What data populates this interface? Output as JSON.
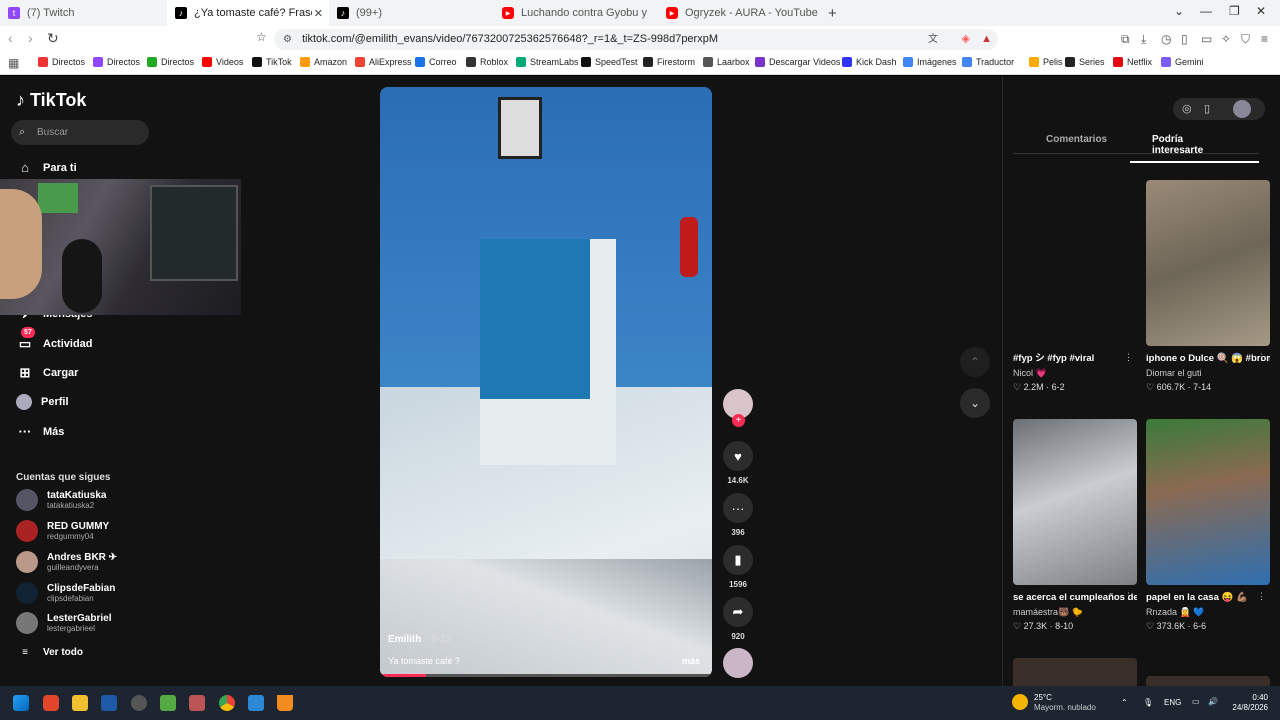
{
  "tabs": [
    {
      "label": "(7) Twitch",
      "color": "#9146ff",
      "glyph": "t"
    },
    {
      "label": "¿Ya tomaste café? Frases y respu...",
      "color": "#000",
      "glyph": "♪",
      "active": true
    },
    {
      "label": "(99+)",
      "color": "#000",
      "glyph": "♪"
    },
    {
      "label": "Luchando contra Gyobu y el Toro lla...",
      "color": "#ff0000",
      "glyph": "▶"
    },
    {
      "label": "Ogryzek - AURA - YouTube",
      "color": "#ff0000",
      "glyph": "▶"
    }
  ],
  "url": "tiktok.com/@emilith_evans/video/7673200725362576648?_r=1&_t=ZS-998d7perxpM",
  "bookmarks": [
    {
      "label": "Directos",
      "color": "#e33"
    },
    {
      "label": "Directos",
      "color": "#9146ff"
    },
    {
      "label": "Directos",
      "color": "#2a2"
    },
    {
      "label": "Videos",
      "color": "#f00"
    },
    {
      "label": "TikTok",
      "color": "#111"
    },
    {
      "label": "Amazon",
      "color": "#f90"
    },
    {
      "label": "AliExpress",
      "color": "#e43"
    },
    {
      "label": "Correo",
      "color": "#1a73e8"
    },
    {
      "label": "Roblox",
      "color": "#333"
    },
    {
      "label": "StreamLabs",
      "color": "#0a7"
    },
    {
      "label": "SpeedTest",
      "color": "#111"
    },
    {
      "label": "Firestorm",
      "color": "#222"
    },
    {
      "label": "Laarbox",
      "color": "#555"
    },
    {
      "label": "Descargar Videos",
      "color": "#73c"
    },
    {
      "label": "Kick Dash",
      "color": "#33f"
    },
    {
      "label": "Imágenes",
      "color": "#4285f4"
    },
    {
      "label": "Traductor",
      "color": "#4285f4"
    },
    {
      "label": "Pelis",
      "color": "#fa0"
    },
    {
      "label": "Series",
      "color": "#222"
    },
    {
      "label": "Netflix",
      "color": "#e50914"
    },
    {
      "label": "Gemini",
      "color": "#7b5cf5"
    }
  ],
  "sidebar": {
    "logo": "TikTok",
    "search_placeholder": "Buscar",
    "nav": [
      {
        "label": "Para ti",
        "icon": "⌂"
      },
      {
        "label": "Mensajes",
        "icon": "✈"
      },
      {
        "label": "Actividad",
        "icon": "▭",
        "badge": "57"
      },
      {
        "label": "Cargar",
        "icon": "⊞"
      },
      {
        "label": "Perfil",
        "icon": "●"
      },
      {
        "label": "Más",
        "icon": "···"
      }
    ],
    "following_title": "Cuentas que sigues",
    "accounts": [
      {
        "name": "tataKatiuska",
        "handle": "tatakatiuska2",
        "color": "#556"
      },
      {
        "name": "RED GUMMY",
        "handle": "redgummy04",
        "color": "#a22"
      },
      {
        "name": "Andres BKR ✈",
        "handle": "guilleandyvera",
        "color": "#b98"
      },
      {
        "name": "ClipsdeFabian",
        "handle": "clipsdefabian",
        "color": "#123"
      },
      {
        "name": "LesterGabriel",
        "handle": "lestergabrieel",
        "color": "#777"
      }
    ],
    "see_all": "Ver todo"
  },
  "video": {
    "author": "Emilith",
    "date": "· 8-12",
    "caption": "Ya tomaste café ?",
    "more": "más",
    "progress": 0.14
  },
  "actions": [
    {
      "icon": "♥",
      "count": "14.6K"
    },
    {
      "icon": "···",
      "count": "396"
    },
    {
      "icon": "▮",
      "count": "1596"
    },
    {
      "icon": "➦",
      "count": "920"
    }
  ],
  "right": {
    "tab_comments": "Comentarios",
    "tab_interest": "Podría interesarte",
    "cards": [
      {
        "title": "#fyp シ #fyp #viral",
        "author": "Nicol 💗",
        "meta": "♡ 2.2M · 6-2",
        "thumb": "#121212"
      },
      {
        "title": "iphone o Dulce 🍭 😱 #bromas #ParaTiPage...",
        "author": "Diomar el guti",
        "meta": "♡ 606.7K · 7-14",
        "thumb": "linear-gradient(160deg,#9a8a78,#6e6657 50%,#a59a86)"
      },
      {
        "title": "se acerca el cumpleaños del rey... ...",
        "author": "mamáestra🐻 🐤",
        "meta": "♡ 27.3K · 8-10",
        "thumb": "linear-gradient(160deg,#6b6f73,#c9ccd0 45%,#7d8185)"
      },
      {
        "title": "papel en la casa 😝 💪🏽",
        "author": "Rnzada 🧝 💙",
        "meta": "♡ 373.6K · 6-6",
        "thumb": "linear-gradient(170deg,#3a7a3a,#8a6a52 40%,#2f6fb0)"
      }
    ]
  },
  "taskbar": {
    "weather_temp": "25°C",
    "weather_desc": "Mayorm. nublado",
    "lang": "ENG",
    "time": "0:40",
    "date": "24/8/2026"
  }
}
